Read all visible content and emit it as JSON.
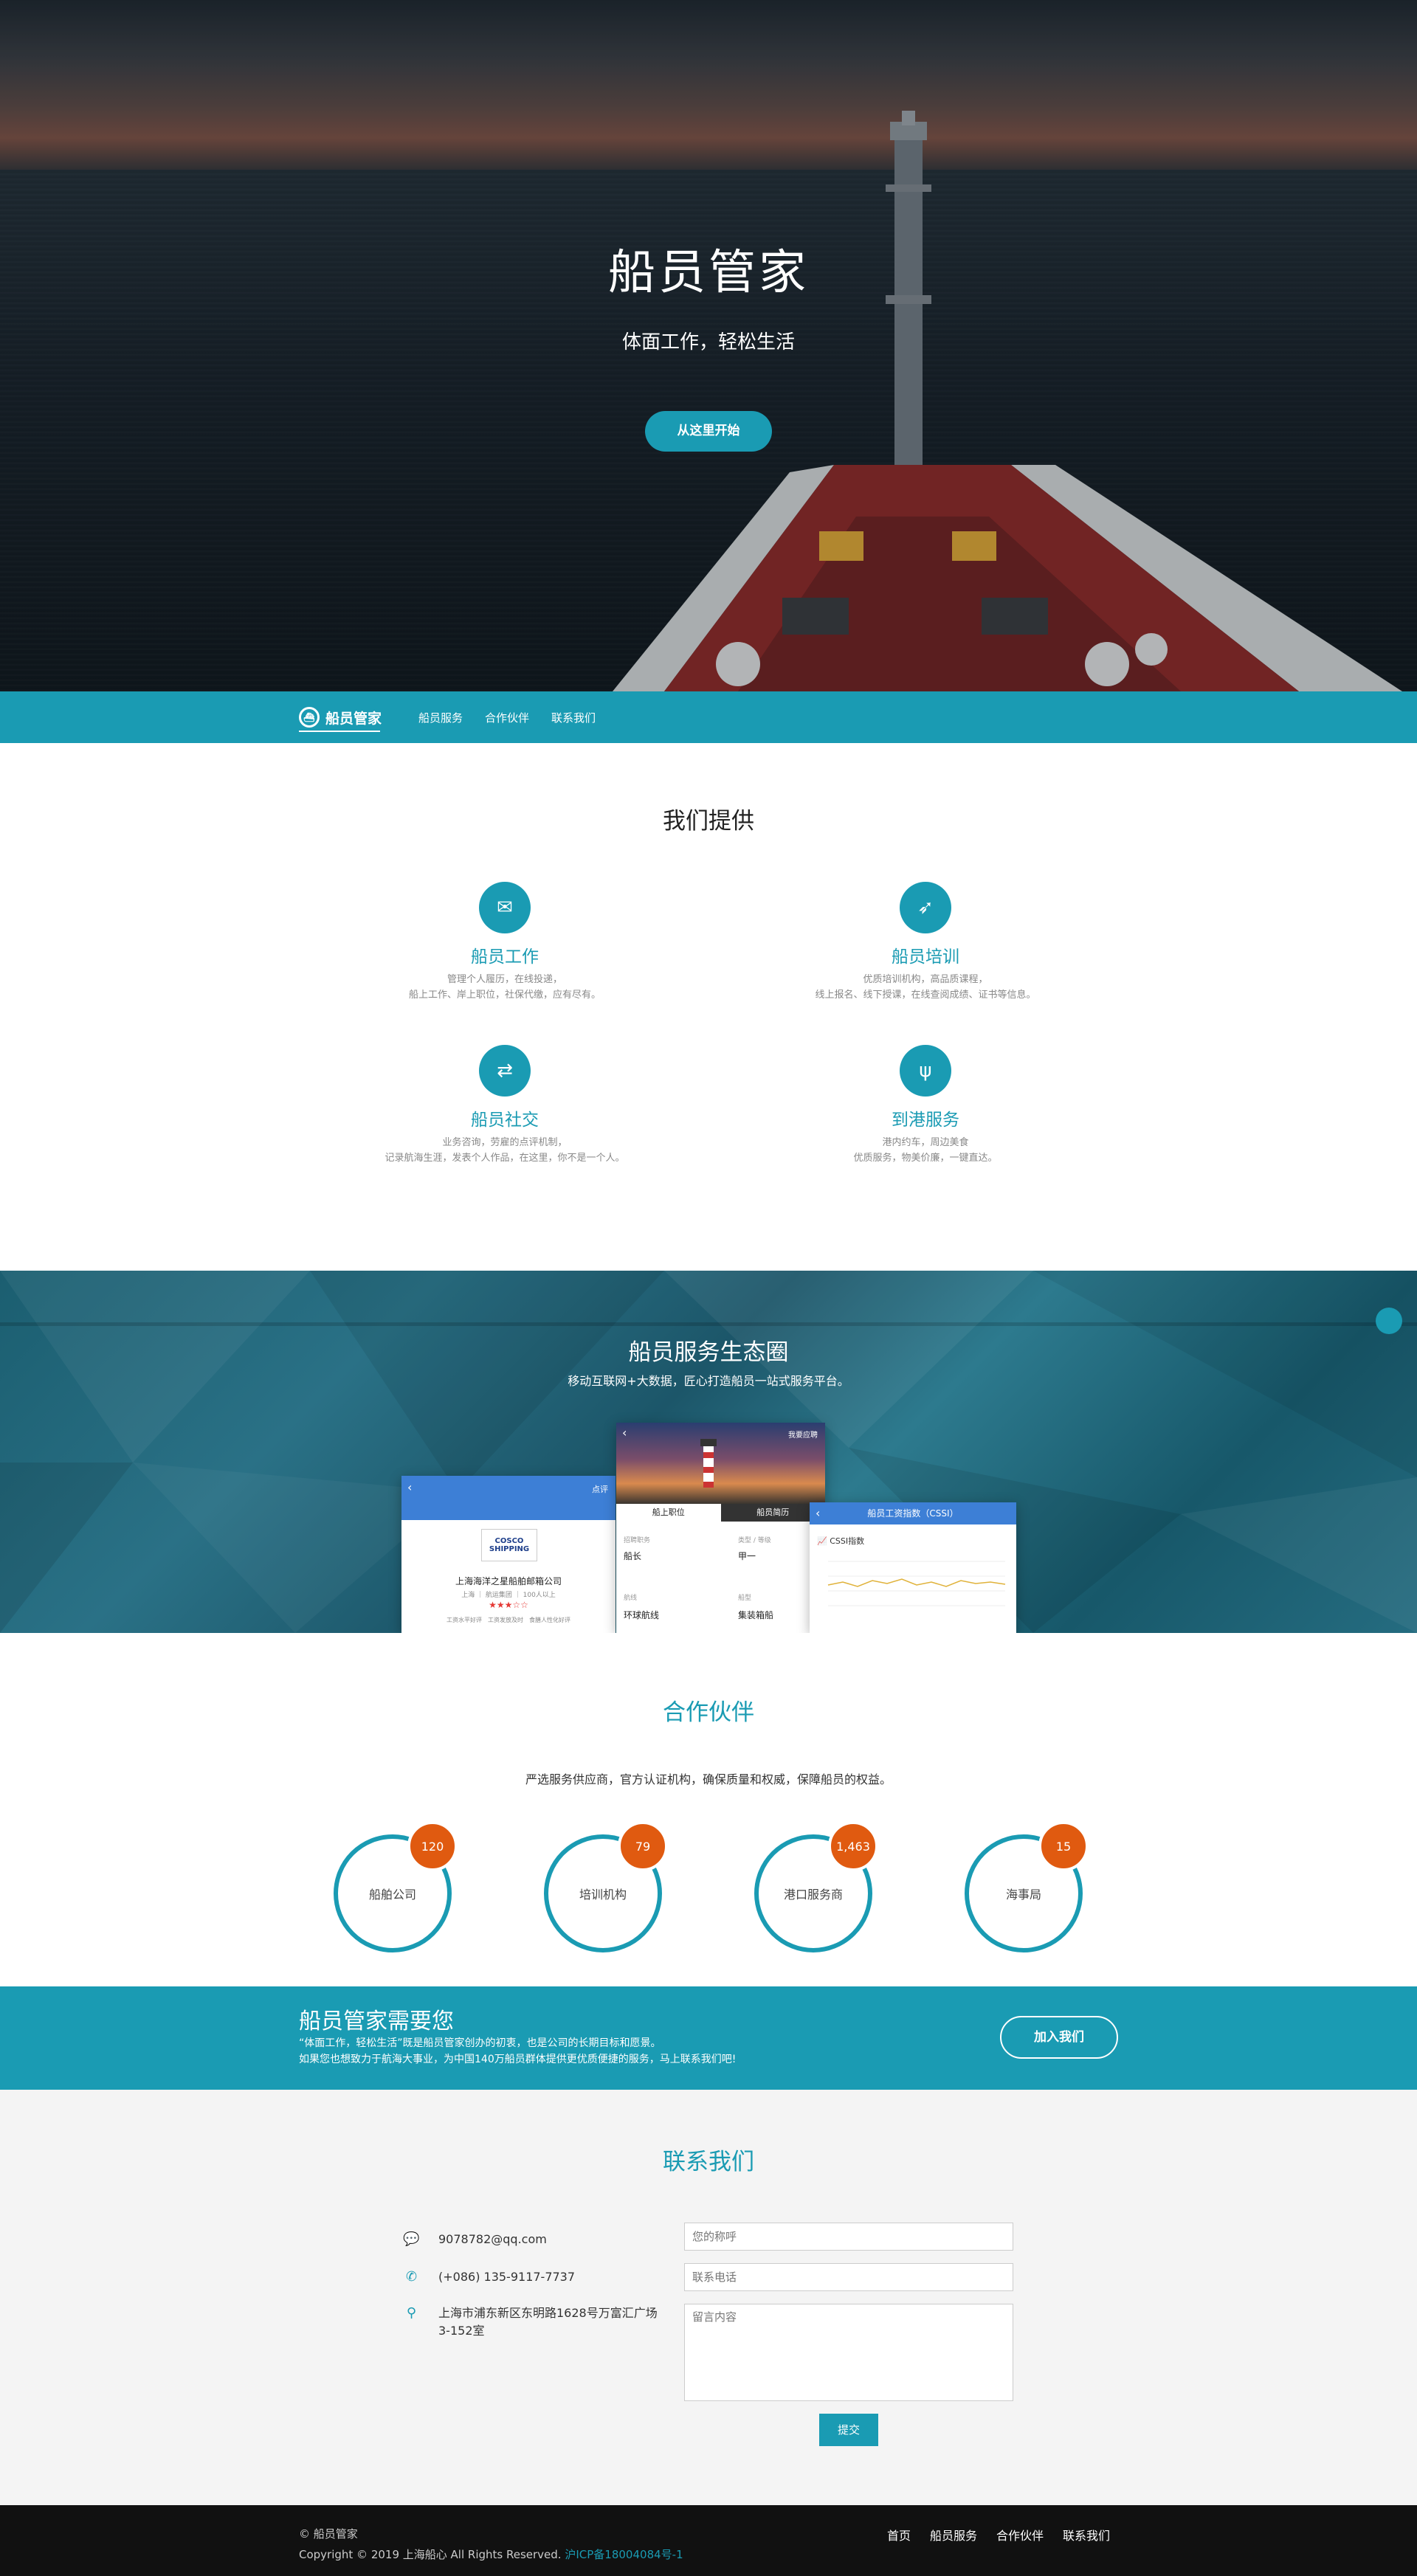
{
  "hero": {
    "title": "船员管家",
    "subtitle": "体面工作，轻松生活",
    "cta_label": "从这里开始"
  },
  "nav": {
    "brand": "船员管家",
    "links": [
      "船员服务",
      "合作伙伴",
      "联系我们"
    ]
  },
  "services": {
    "title": "我们提供",
    "items": [
      {
        "icon": "mail-icon",
        "name": "船员工作",
        "desc1": "管理个人履历，在线投递，",
        "desc2": "船上工作、岸上职位，社保代缴，应有尽有。"
      },
      {
        "icon": "rocket-icon",
        "name": "船员培训",
        "desc1": "优质培训机构，高品质课程，",
        "desc2": "线上报名、线下授课，在线查阅成绩、证书等信息。"
      },
      {
        "icon": "handshake-icon",
        "name": "船员社交",
        "desc1": "业务咨询，劳雇的点评机制，",
        "desc2": "记录航海生涯，发表个人作品，在这里，你不是一个人。"
      },
      {
        "icon": "utensils-icon",
        "name": "到港服务",
        "desc1": "港内约车，周边美食",
        "desc2": "优质服务，物美价廉，一键直达。"
      }
    ]
  },
  "ecosystem": {
    "title": "船员服务生态圈",
    "subtitle": "移动互联网+大数据，匠心打造船员一站式服务平台。",
    "phone_left": {
      "header_action": "点评",
      "logo": "COSCO SHIPPING",
      "company": "上海海洋之星船舶邮箱公司",
      "meta": "上海 ｜ 航运集团 ｜ 100人以上",
      "stats": "工资水平好评　工资发放及时　食膳人性化好评"
    },
    "phone_middle": {
      "header_action": "我要应聘",
      "tab_active": "船上职位",
      "tab_other": "船员简历",
      "rows": [
        {
          "label1": "招聘职务",
          "value1": "船长",
          "label2": "类型 / 等级",
          "value2": "甲一"
        },
        {
          "label1": "航线",
          "value1": "环球航线",
          "label2": "船型",
          "value2": "集装箱船"
        }
      ]
    },
    "phone_right": {
      "header": "船员工资指数（CSSI）",
      "chart_label": "CSSI指数"
    }
  },
  "partners": {
    "title": "合作伙伴",
    "subtitle": "严选服务供应商，官方认证机构，确保质量和权威，保障船员的权益。",
    "items": [
      {
        "label": "船舶公司",
        "count": "120"
      },
      {
        "label": "培训机构",
        "count": "79"
      },
      {
        "label": "港口服务商",
        "count": "1,463"
      },
      {
        "label": "海事局",
        "count": "15"
      }
    ]
  },
  "cta": {
    "title": "船员管家需要您",
    "line1": "“体面工作，轻松生活”既是船员管家创办的初衷，也是公司的长期目标和愿景。",
    "line2": "如果您也想致力于航海大事业，为中国140万船员群体提供更优质便捷的服务，马上联系我们吧!",
    "button": "加入我们"
  },
  "contact": {
    "title": "联系我们",
    "email": "9078782@qq.com",
    "phone": "(+086) 135-9117-7737",
    "address1": "上海市浦东新区东明路1628号万富汇广场",
    "address2": "3-152室",
    "name_placeholder": "您的称呼",
    "phone_placeholder": "联系电话",
    "message_placeholder": "留言内容",
    "submit": "提交"
  },
  "footer": {
    "copyright1": "© 船员管家",
    "copyright2": "Copyright © 2019 上海船心 All Rights Reserved.",
    "icp": "沪ICP备18004084号-1",
    "links": [
      "首页",
      "船员服务",
      "合作伙伴",
      "联系我们"
    ]
  },
  "colors": {
    "accent": "#1a9bb3",
    "badge": "#e05a10",
    "footer_bg": "#111111"
  }
}
